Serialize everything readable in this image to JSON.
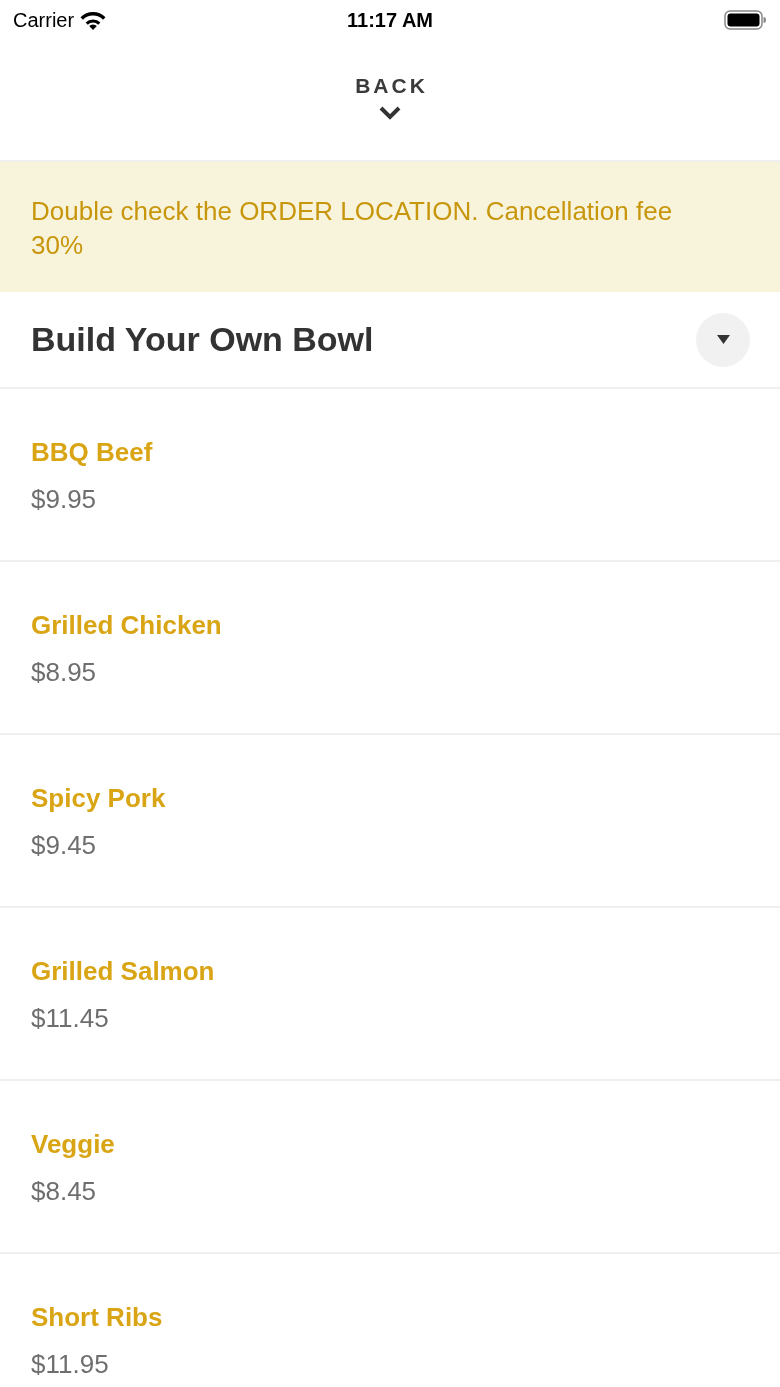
{
  "status_bar": {
    "carrier": "Carrier",
    "time": "11:17 AM"
  },
  "header": {
    "back_label": "BACK"
  },
  "banner": {
    "text": "Double check the ORDER LOCATION. Cancellation fee 30%"
  },
  "section": {
    "title": "Build Your Own Bowl"
  },
  "items": [
    {
      "name": "BBQ Beef",
      "price": "$9.95"
    },
    {
      "name": "Grilled Chicken",
      "price": "$8.95"
    },
    {
      "name": "Spicy Pork",
      "price": "$9.45"
    },
    {
      "name": "Grilled Salmon",
      "price": "$11.45"
    },
    {
      "name": "Veggie",
      "price": "$8.45"
    },
    {
      "name": "Short Ribs",
      "price": "$11.95"
    }
  ]
}
